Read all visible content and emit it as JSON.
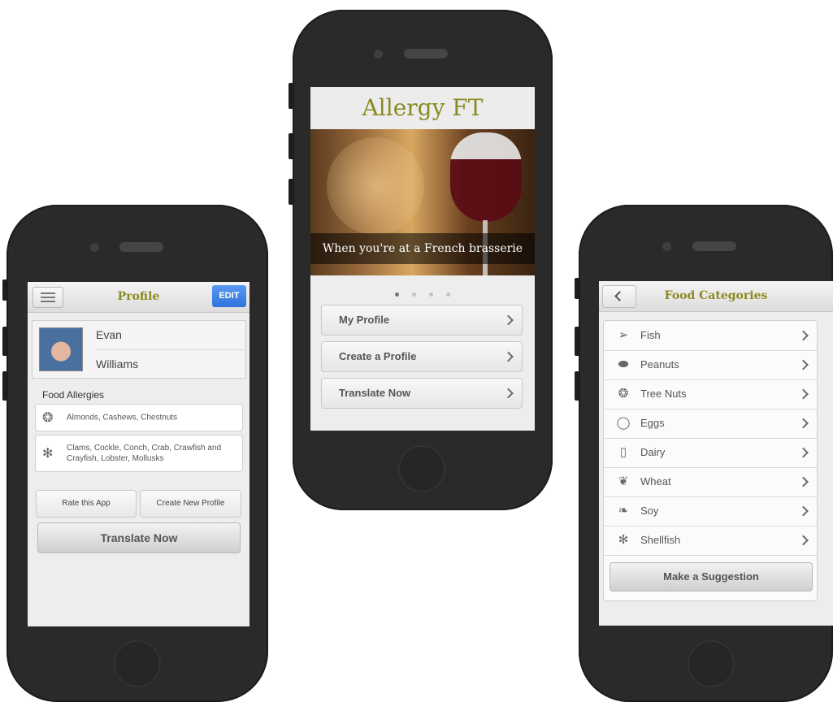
{
  "profile_screen": {
    "nav_title": "Profile",
    "menu_icon": "hamburger-icon",
    "edit_label": "EDIT",
    "first_name": "Evan",
    "last_name": "Williams",
    "section_label": "Food Allergies",
    "allergies": [
      {
        "icon": "nut-icon",
        "text": "Almonds, Cashews, Chestnuts"
      },
      {
        "icon": "crab-icon",
        "text": "Clams, Cockle, Conch, Crab, Crawfish and Crayfish, Lobster, Mollusks"
      }
    ],
    "rate_label": "Rate this App",
    "create_new_label": "Create New Profile",
    "translate_label": "Translate Now"
  },
  "home_screen": {
    "app_title": "Allergy FT",
    "hero_caption": "When you're at a French brasserie",
    "carousel_dots": 4,
    "active_dot": 1,
    "menu": [
      {
        "label": "My Profile"
      },
      {
        "label": "Create a Profile"
      },
      {
        "label": "Translate Now"
      }
    ]
  },
  "categories_screen": {
    "nav_title": "Food Categories",
    "back_icon": "chevron-left-icon",
    "items": [
      {
        "icon": "fish-icon",
        "label": "Fish"
      },
      {
        "icon": "peanut-icon",
        "label": "Peanuts"
      },
      {
        "icon": "tree-nut-icon",
        "label": "Tree Nuts"
      },
      {
        "icon": "egg-icon",
        "label": "Eggs"
      },
      {
        "icon": "milk-icon",
        "label": "Dairy"
      },
      {
        "icon": "wheat-icon",
        "label": "Wheat"
      },
      {
        "icon": "soy-icon",
        "label": "Soy"
      },
      {
        "icon": "crab-icon",
        "label": "Shellfish"
      }
    ],
    "suggestion_label": "Make a Suggestion"
  },
  "colors": {
    "title_olive": "#8a8a22",
    "edit_blue": "#3a7be0",
    "phone_body": "#2a2a2a"
  }
}
